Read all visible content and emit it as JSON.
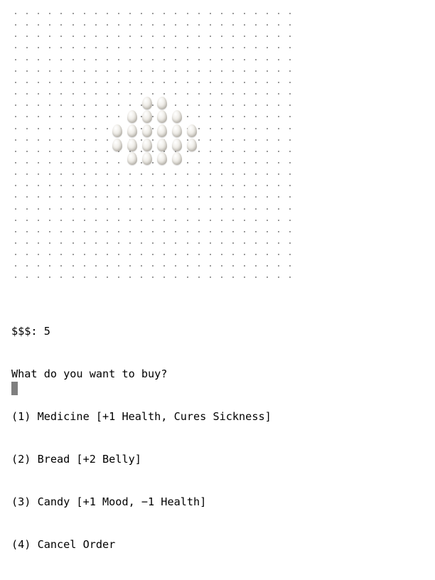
{
  "terminal": {
    "money_line": "$$$: 5",
    "prompt": "What do you want to buy?",
    "options": [
      "(1) Medicine [+1 Health, Cures Sickness]",
      "(2) Bread [+2 Belly]",
      "(3) Candy [+1 Mood, −1 Health]",
      "(4) Cancel Order"
    ]
  },
  "field": {
    "dot_color": "#7a7a7a",
    "sprite": "egg-cluster-pet"
  },
  "cursor": {
    "color": "#7f7f7f"
  }
}
